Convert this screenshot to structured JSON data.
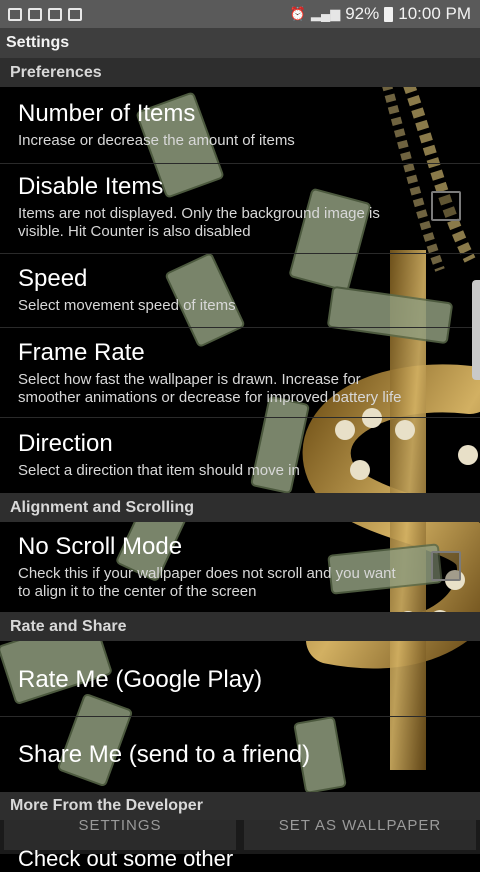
{
  "status_bar": {
    "battery": "92%",
    "time": "10:00 PM"
  },
  "app_title": "Settings",
  "sections": {
    "preferences": "Preferences",
    "alignment": "Alignment and Scrolling",
    "rate_share": "Rate and Share",
    "more": "More From the Developer"
  },
  "prefs": {
    "items": {
      "title": "Number of Items",
      "summary": "Increase or decrease the amount of items"
    },
    "disable": {
      "title": "Disable Items",
      "summary": "Items are not displayed. Only the background image is visible. Hit Counter is also disabled",
      "checked": false
    },
    "speed": {
      "title": "Speed",
      "summary": "Select movement speed of items"
    },
    "frame_rate": {
      "title": "Frame Rate",
      "summary": "Select how fast the wallpaper is drawn. Increase for smoother animations or decrease for improved battery life"
    },
    "direction": {
      "title": "Direction",
      "summary": "Select a direction that item should move in"
    },
    "no_scroll": {
      "title": "No Scroll Mode",
      "summary": "Check this if your wallpaper does not scroll and you want to align it to the center of the screen",
      "checked": false
    },
    "rate": {
      "title": "Rate Me (Google Play)"
    },
    "share": {
      "title": "Share Me (send to a friend)"
    }
  },
  "bottom_bar": {
    "settings": "SETTINGS",
    "set_wallpaper": "SET AS WALLPAPER"
  },
  "peek_text": "Check out some other",
  "colors": {
    "gold": "#b08a3a",
    "money_green": "#8f9c7e",
    "section_bg": "#2e2e2e"
  }
}
